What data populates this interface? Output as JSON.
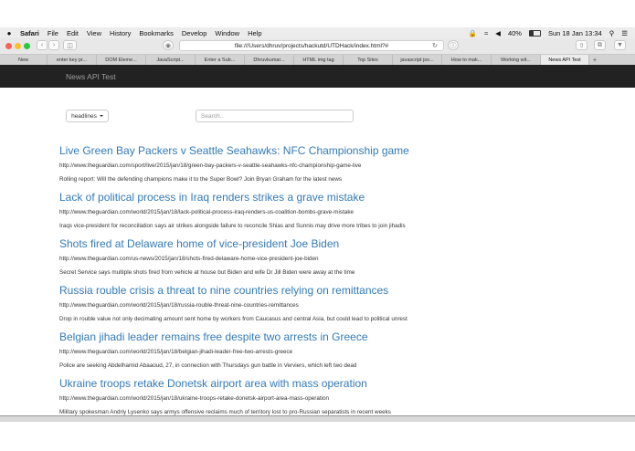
{
  "menubar": {
    "apple": "",
    "app": "Safari",
    "items": [
      "File",
      "Edit",
      "View",
      "History",
      "Bookmarks",
      "Develop",
      "Window",
      "Help"
    ],
    "battery": "40%",
    "datetime": "Sun 18 Jan  13:34"
  },
  "toolbar": {
    "address": "file:///Users/dhruv/projects/hackutd/UTDHack/index.html?#"
  },
  "tabs": [
    "New",
    "enter key pr...",
    "DOM Eleme...",
    "JavaScript...",
    "Enter a Sub...",
    "Dhruvkumar...",
    "HTML img tag",
    "Top Sites",
    "javascript jso...",
    "How to mak...",
    "Working wit...",
    "News API Test"
  ],
  "navbar": {
    "brand": "News API Test"
  },
  "controls": {
    "dropdown_label": "headlines",
    "search_placeholder": "Search.."
  },
  "articles": [
    {
      "title": "Live Green Bay Packers v Seattle Seahawks: NFC Championship game",
      "url": "http://www.theguardian.com/sport/live/2015/jan/18/green-bay-packers-v-seattle-seahawks-nfc-championship-game-live",
      "desc": "Rolling report: Will the defending champions make it to the Super Bowl? Join Bryan Graham for the latest news"
    },
    {
      "title": "Lack of political process in Iraq renders strikes a grave mistake",
      "url": "http://www.theguardian.com/world/2015/jan/18/lack-political-process-iraq-renders-us-coalition-bombs-grave-mistake",
      "desc": "Iraqs vice-president for reconciliation says air strikes alongside failure to reconcile Shias and Sunnis may drive more tribes to join jihadis"
    },
    {
      "title": "Shots fired at Delaware home of vice-president Joe Biden",
      "url": "http://www.theguardian.com/us-news/2015/jan/18/shots-fired-delaware-home-vice-president-joe-biden",
      "desc": "Secret Service says multiple shots fired from vehicle at house but Biden and wife Dr Jill Biden were away at the time"
    },
    {
      "title": "Russia rouble crisis a threat to nine countries relying on remittances",
      "url": "http://www.theguardian.com/world/2015/jan/18/russia-rouble-threat-nine-countries-remittances",
      "desc": "Drop in rouble value not only decimating amount sent home by workers from Caucasus and central Asia, but could lead to political unrest"
    },
    {
      "title": "Belgian jihadi leader remains free despite two arrests in Greece",
      "url": "http://www.theguardian.com/world/2015/jan/18/belgian-jihadi-leader-free-two-arrests-greece",
      "desc": "Police are seeking Abdelhamid Abaaoud, 27, in connection with Thursdays gun battle in Verviers, which left two dead"
    },
    {
      "title": "Ukraine troops retake Donetsk airport area with mass operation",
      "url": "http://www.theguardian.com/world/2015/jan/18/ukraine-troops-retake-donetsk-airport-area-mass-operation",
      "desc": "Military spokesman Andriy Lysenko says armys offensive reclaims much of territory lost to pro-Russian separatists in recent weeks"
    }
  ],
  "colors": {
    "navbar_bg": "#222222",
    "link": "#337ab7",
    "close_light": "#ff5f57",
    "minimize_light": "#febc2e",
    "zoom_light": "#28c840"
  }
}
